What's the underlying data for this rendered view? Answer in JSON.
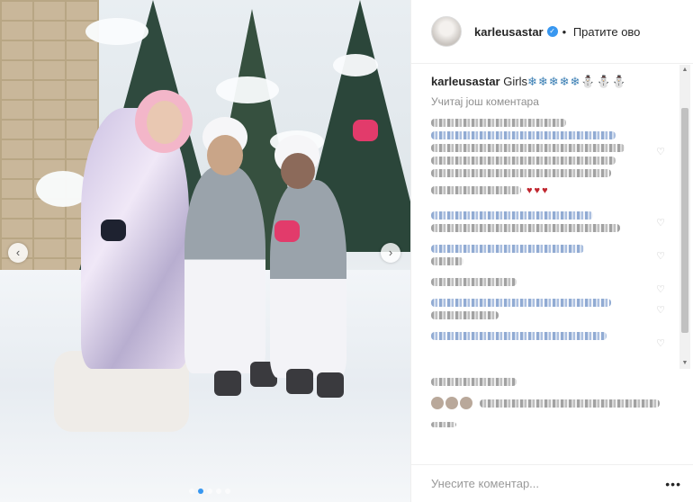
{
  "header": {
    "username": "karleusastar",
    "verified_icon": "verified-badge-icon",
    "separator": "•",
    "follow_label": "Пратите ово"
  },
  "caption": {
    "username": "karleusastar",
    "text": "Girls",
    "emojis": "❄❄❄❄❄⛄⛄⛄"
  },
  "comments": {
    "load_more": "Учитај још коментара",
    "hearts": "♥♥♥"
  },
  "comment_box": {
    "placeholder": "Унесите коментар...",
    "more_label": "•••"
  },
  "media": {
    "prev_icon": "chevron-left-icon",
    "next_icon": "chevron-right-icon",
    "prev_glyph": "‹",
    "next_glyph": "›",
    "slide_count": 5,
    "active_slide": 2
  },
  "colors": {
    "accent": "#3897f0",
    "text": "#262626",
    "muted": "#8e8e8e"
  }
}
